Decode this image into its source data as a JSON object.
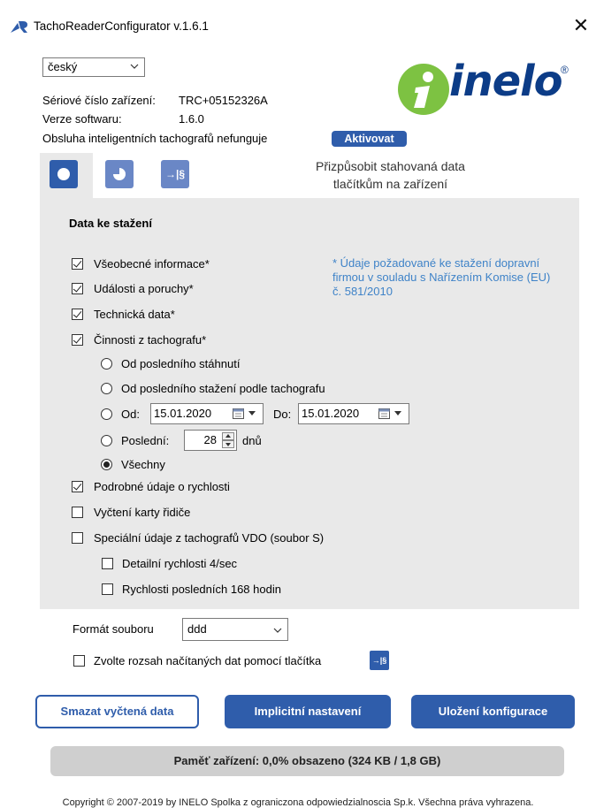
{
  "window": {
    "title": "TachoReaderConfigurator v.1.6.1"
  },
  "language": {
    "selected": "český"
  },
  "device": {
    "serial_label": "Sériové číslo zařízení:",
    "serial_value": "TRC+05152326A",
    "version_label": "Verze softwaru:",
    "version_value": "1.6.0",
    "smart_status": "Obsluha inteligentních tachografů nefunguje",
    "activate_label": "Aktivovat"
  },
  "logo": {
    "word": "inelo",
    "mark": "®"
  },
  "tabs": {
    "icons": [
      "circle-icon",
      "moon-icon",
      "arrow-section-icon"
    ],
    "third_icon_text": "→|§",
    "note": "Přizpůsobit stahovaná data tlačítkům na zařízení"
  },
  "download": {
    "section_title": "Data ke stažení",
    "note": "* Údaje požadované ke stažení dopravní firmou v souladu s Nařízením Komise (EU) č. 581/2010",
    "items": [
      {
        "label": "Všeobecné informace*",
        "checked": true
      },
      {
        "label": "Události a poruchy*",
        "checked": true
      },
      {
        "label": "Technická data*",
        "checked": true
      },
      {
        "label": "Činnosti z tachografu*",
        "checked": true
      }
    ],
    "radios": {
      "since_last": "Od posledního stáhnutí",
      "since_last_tacho": "Od posledního stažení podle tachografu",
      "from_label": "Od:",
      "from_date": "15.01.2020",
      "to_label": "Do:",
      "to_date": "15.01.2020",
      "last_label": "Poslední:",
      "last_value": "28",
      "days_label": "dnů",
      "all_label": "Všechny",
      "selected": "all"
    },
    "extra": [
      {
        "label": "Podrobné údaje o rychlosti",
        "checked": true
      },
      {
        "label": "Vyčtení karty řidiče",
        "checked": false
      },
      {
        "label": "Speciální údaje z tachografů VDO (soubor S)",
        "checked": false
      }
    ],
    "vdo_sub": [
      {
        "label": "Detailní rychlosti 4/sec",
        "checked": false
      },
      {
        "label": "Rychlosti posledních 168 hodin",
        "checked": false
      }
    ]
  },
  "file_format": {
    "label": "Formát souboru",
    "value": "ddd"
  },
  "range_option": {
    "label": "Zvolte rozsah načítaných dat pomocí tlačítka",
    "checked": false,
    "icon_text": "→|§"
  },
  "buttons": {
    "clear": "Smazat vyčtená data",
    "defaults": "Implicitní nastavení",
    "save": "Uložení konfigurace"
  },
  "memory": "Paměť zařízení: 0,0% obsazeno (324 KB / 1,8 GB)",
  "copyright": "Copyright © 2007-2019 by INELO Spolka z ograniczona odpowiedzialnoscia Sp.k. Všechna práva vyhrazena.",
  "colors": {
    "brand_blue": "#2f5dab",
    "tab_blue": "#6a87c6",
    "logo_green": "#7dc242",
    "logo_navy": "#0c3c87",
    "note_blue": "#3f83c8"
  }
}
